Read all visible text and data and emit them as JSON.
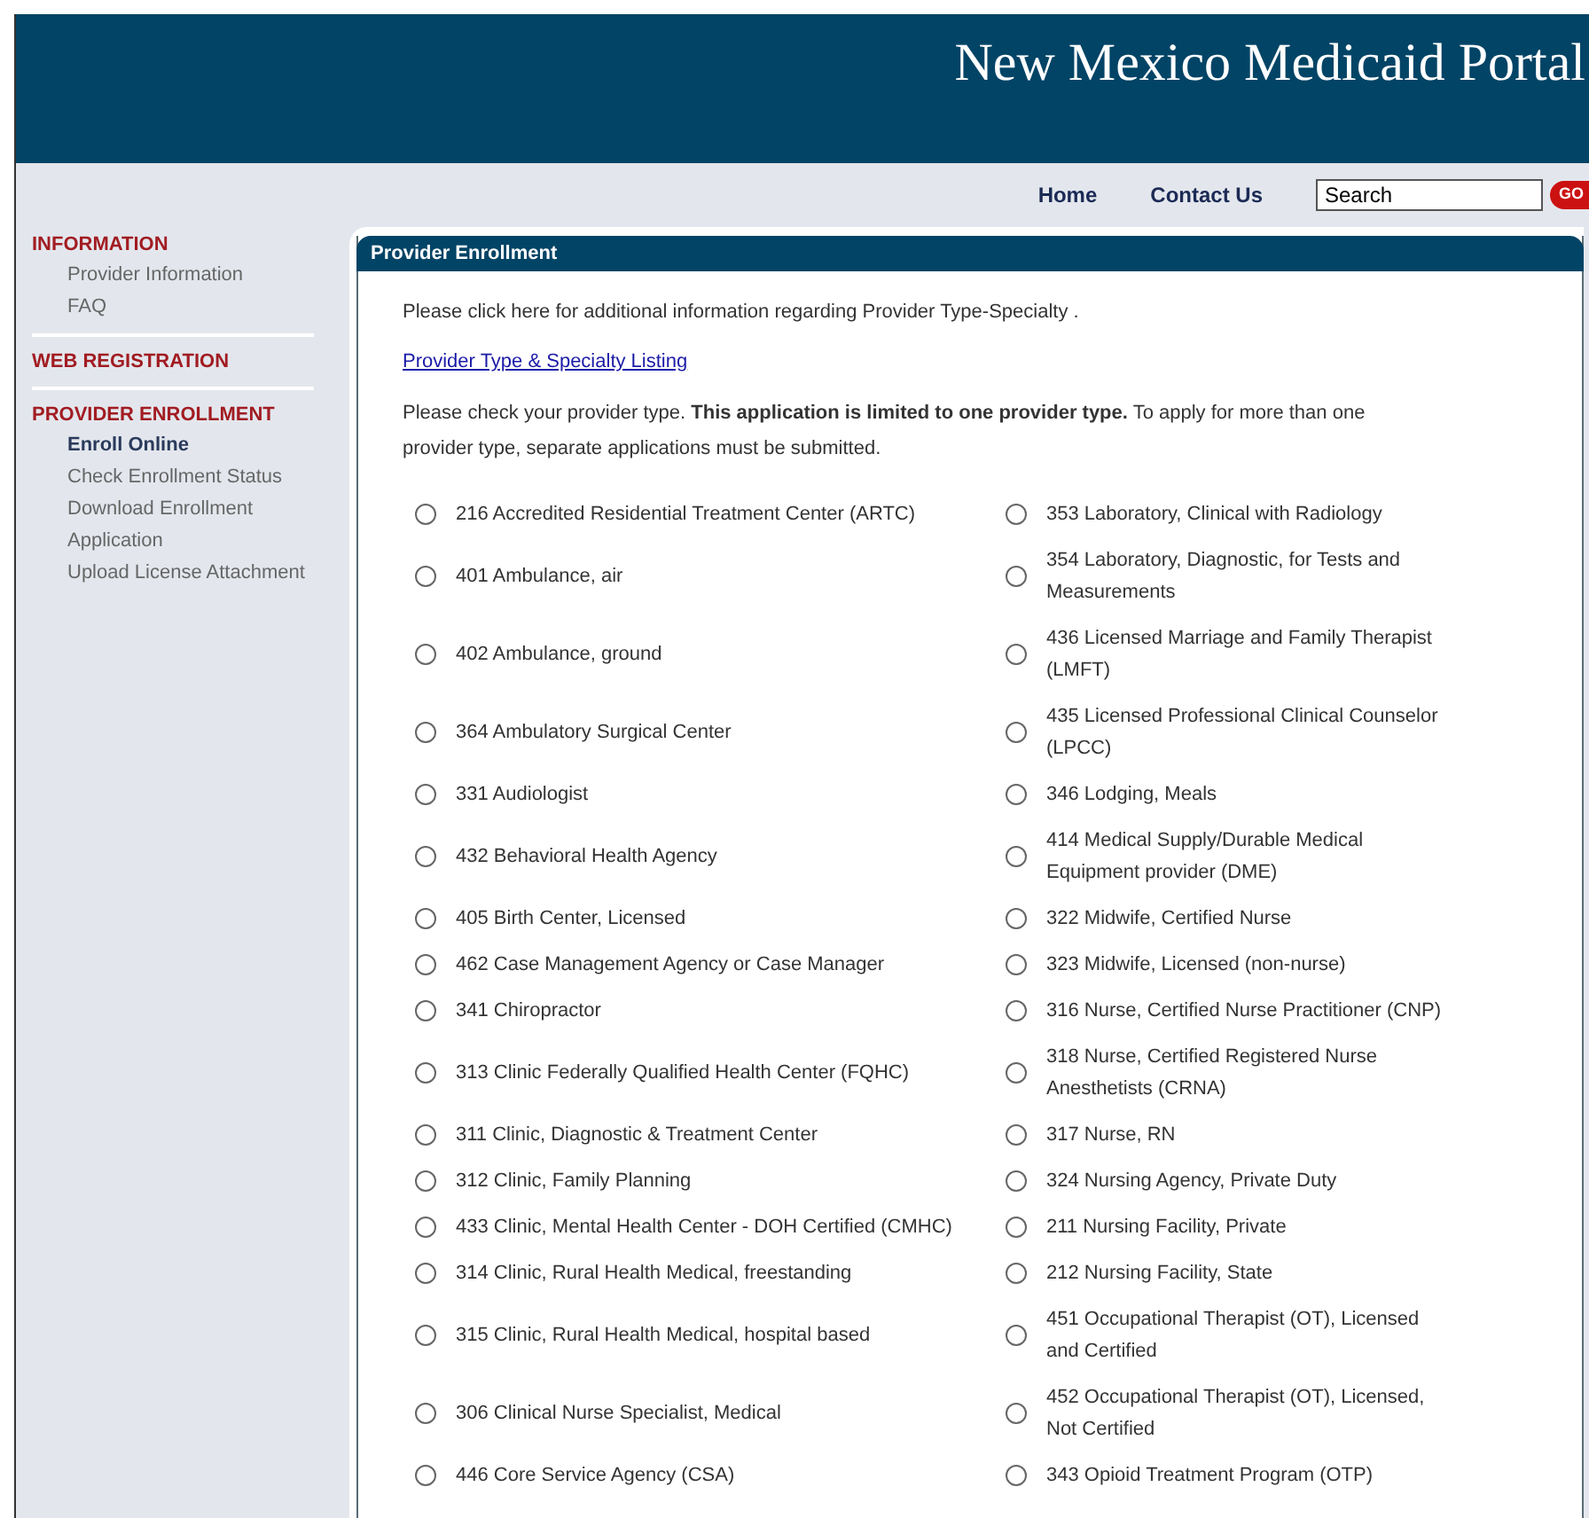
{
  "header": {
    "title": "New Mexico Medicaid Portal"
  },
  "nav": {
    "links": [
      "Home",
      "Contact Us"
    ],
    "search": {
      "value": "Search"
    },
    "go_button": "GO"
  },
  "sidebar": {
    "sections": [
      {
        "title": "INFORMATION",
        "items": [
          {
            "label": "Provider Information",
            "selected": false
          },
          {
            "label": "FAQ",
            "selected": false
          }
        ]
      },
      {
        "title": "WEB REGISTRATION"
      },
      {
        "title": "PROVIDER ENROLLMENT",
        "items": [
          {
            "label": "Enroll Online",
            "selected": true
          },
          {
            "label": "Check Enrollment Status",
            "selected": false
          },
          {
            "label": "Download Enrollment Application",
            "selected": false
          },
          {
            "label": "Upload License Attachment",
            "selected": false
          }
        ]
      }
    ]
  },
  "panel": {
    "title": "Provider Enrollment",
    "intro": "Please click here for additional information regarding Provider Type-Specialty .",
    "link": "Provider Type & Specialty Listing",
    "instructions": "Please check your provider type. **This application is limited to one provider type.** To apply for more than one provider type, separate applications must be submitted.",
    "rows": [
      [
        {
          "label": "216 Accredited Residential Treatment Center (ARTC)",
          "selected": false
        },
        {
          "label": "353 Laboratory, Clinical with Radiology",
          "selected": false
        }
      ],
      [
        {
          "label": "401 Ambulance, air",
          "selected": false
        },
        {
          "label": "354 Laboratory, Diagnostic, for Tests and Measurements",
          "selected": false
        }
      ],
      [
        {
          "label": "402 Ambulance, ground",
          "selected": false
        },
        {
          "label": "436 Licensed Marriage and Family Therapist (LMFT)",
          "selected": false
        }
      ],
      [
        {
          "label": "364 Ambulatory Surgical Center",
          "selected": false
        },
        {
          "label": "435 Licensed Professional Clinical Counselor (LPCC)",
          "selected": false
        }
      ],
      [
        {
          "label": "331 Audiologist",
          "selected": false
        },
        {
          "label": "346 Lodging, Meals",
          "selected": false
        }
      ],
      [
        {
          "label": "432 Behavioral Health Agency",
          "selected": false
        },
        {
          "label": "414 Medical Supply/Durable Medical Equipment provider (DME)",
          "selected": false
        }
      ],
      [
        {
          "label": "405 Birth Center, Licensed",
          "selected": false
        },
        {
          "label": "322 Midwife, Certified Nurse",
          "selected": false
        }
      ],
      [
        {
          "label": "462 Case Management Agency or Case Manager",
          "selected": false
        },
        {
          "label": "323 Midwife, Licensed (non-nurse)",
          "selected": false
        }
      ],
      [
        {
          "label": "341 Chiropractor",
          "selected": false
        },
        {
          "label": "316 Nurse, Certified Nurse Practitioner (CNP)",
          "selected": false
        }
      ],
      [
        {
          "label": "313 Clinic Federally Qualified Health Center (FQHC)",
          "selected": false
        },
        {
          "label": "318 Nurse, Certified Registered Nurse Anesthetists (CRNA)",
          "selected": false
        }
      ],
      [
        {
          "label": "311 Clinic, Diagnostic & Treatment Center",
          "selected": false
        },
        {
          "label": "317 Nurse, RN",
          "selected": false
        }
      ],
      [
        {
          "label": "312 Clinic, Family Planning",
          "selected": false
        },
        {
          "label": "324 Nursing Agency, Private Duty",
          "selected": false
        }
      ],
      [
        {
          "label": "433 Clinic, Mental Health Center - DOH Certified (CMHC)",
          "selected": false
        },
        {
          "label": "211 Nursing Facility, Private",
          "selected": false
        }
      ],
      [
        {
          "label": "314 Clinic, Rural Health Medical, freestanding",
          "selected": false
        },
        {
          "label": "212 Nursing Facility, State",
          "selected": false
        }
      ],
      [
        {
          "label": "315 Clinic, Rural Health Medical, hospital based",
          "selected": false
        },
        {
          "label": "451 Occupational Therapist (OT), Licensed and Certified",
          "selected": false
        }
      ],
      [
        {
          "label": "306 Clinical Nurse Specialist, Medical",
          "selected": false
        },
        {
          "label": "452 Occupational Therapist (OT), Licensed, Not Certified",
          "selected": false
        }
      ],
      [
        {
          "label": "446 Core Service Agency (CSA)",
          "selected": false
        },
        {
          "label": "343 Opioid Treatment Program (OTP)",
          "selected": false
        }
      ]
    ]
  }
}
